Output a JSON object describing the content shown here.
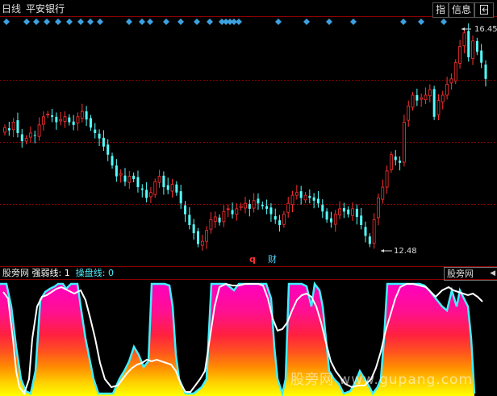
{
  "header": {
    "period": "日线",
    "stock_name": "平安银行",
    "btn_zhi": "指",
    "btn_info": "信息",
    "btn_arrow_icon": "exit-icon"
  },
  "price_labels": {
    "high": "16.45",
    "low": "12.48"
  },
  "markers": {
    "q": "q",
    "cai": "财"
  },
  "indicator": {
    "name": "股旁网",
    "line1_label": "强弱线:",
    "line1_value": "1",
    "line2_label": "操盘线:",
    "line2_value": "0",
    "right_tab": "股旁网"
  },
  "watermark": "股旁网 www.gupang.com",
  "colors": {
    "up": "#ff3232",
    "down": "#54ffff",
    "bg": "#000000",
    "grid": "#8b0000",
    "signal": "#3da1e0"
  },
  "chart_data": {
    "type": "candlestick",
    "price_high": 16.45,
    "price_low": 12.48,
    "closes": [
      14.7,
      14.65,
      14.8,
      14.6,
      14.45,
      14.5,
      14.6,
      14.55,
      14.75,
      14.9,
      14.95,
      14.9,
      14.8,
      14.85,
      14.9,
      14.8,
      14.75,
      14.9,
      15.0,
      14.85,
      14.7,
      14.6,
      14.5,
      14.35,
      14.2,
      14.0,
      13.8,
      13.85,
      13.7,
      13.8,
      13.75,
      13.6,
      13.55,
      13.4,
      13.5,
      13.7,
      13.8,
      13.6,
      13.55,
      13.65,
      13.5,
      13.3,
      13.1,
      12.9,
      12.75,
      12.55,
      12.6,
      12.8,
      13.0,
      13.05,
      12.95,
      13.15,
      13.2,
      13.1,
      13.2,
      13.25,
      13.3,
      13.2,
      13.35,
      13.3,
      13.25,
      13.2,
      13.1,
      13.0,
      12.9,
      13.1,
      13.3,
      13.45,
      13.5,
      13.4,
      13.45,
      13.4,
      13.35,
      13.3,
      13.15,
      13.0,
      12.95,
      13.1,
      13.2,
      13.15,
      13.1,
      13.2,
      13.05,
      12.9,
      12.7,
      12.55,
      13.0,
      13.4,
      13.6,
      13.9,
      14.2,
      14.1,
      14.05,
      14.8,
      15.1,
      15.3,
      15.2,
      15.25,
      15.3,
      15.4,
      14.9,
      15.2,
      15.3,
      15.5,
      15.6,
      15.9,
      16.2,
      16.45,
      16.0,
      16.3,
      16.1,
      15.9,
      15.6
    ]
  }
}
